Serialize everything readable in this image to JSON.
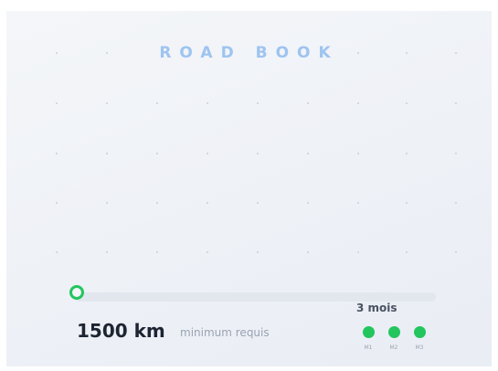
{
  "header": {
    "title": "ROAD BOOK"
  },
  "progress": {
    "value": 0.0
  },
  "distance": {
    "value": "1500 km",
    "note": "minimum requis"
  },
  "duration": {
    "label": "3 mois",
    "months": [
      {
        "label": "M1",
        "status": "done"
      },
      {
        "label": "M2",
        "status": "done"
      },
      {
        "label": "M3",
        "status": "done"
      }
    ]
  },
  "colors": {
    "accent": "#22c55e",
    "title": "#9ec4f0",
    "text_dark": "#1d2433",
    "text_muted": "#9aa3b2",
    "track": "#e2e7ee"
  }
}
